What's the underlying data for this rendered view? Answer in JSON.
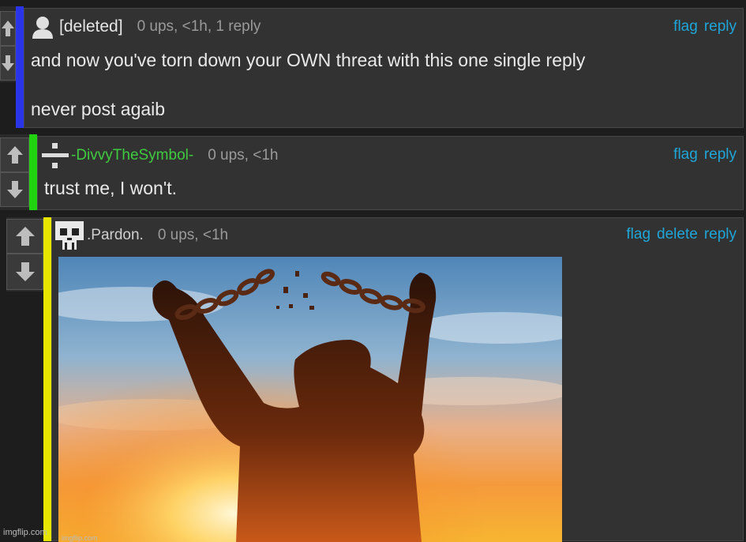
{
  "comments": [
    {
      "username": "[deleted]",
      "meta": "0 ups, <1h, 1 reply",
      "actions": [
        "flag",
        "reply"
      ],
      "body_line1": "and now you've torn down your OWN threat with this one single reply",
      "body_line2": "never post agaib",
      "bar_color": "#2b35e8",
      "avatar_icon": "user-silhouette-icon"
    },
    {
      "username": "-DivvyTheSymbol-",
      "meta": "0 ups, <1h",
      "actions": [
        "flag",
        "reply"
      ],
      "body": "trust me, I won't.",
      "bar_color": "#22d40f",
      "username_color": "#3fcb3f",
      "avatar_icon": "division-sign-icon"
    },
    {
      "username": ".Pardon.",
      "meta": "0 ups, <1h",
      "actions": [
        "flag",
        "delete",
        "reply"
      ],
      "bar_color": "#e6e600",
      "avatar_icon": "pixel-skull-icon",
      "image_desc": "man-breaking-chains-sunset-image"
    }
  ],
  "colors": {
    "link": "#1fa6d8",
    "background": "#1d1d1d",
    "panel": "#323232"
  },
  "watermarks": {
    "outer": "imgflip.com",
    "inner": "imgflip.com"
  }
}
